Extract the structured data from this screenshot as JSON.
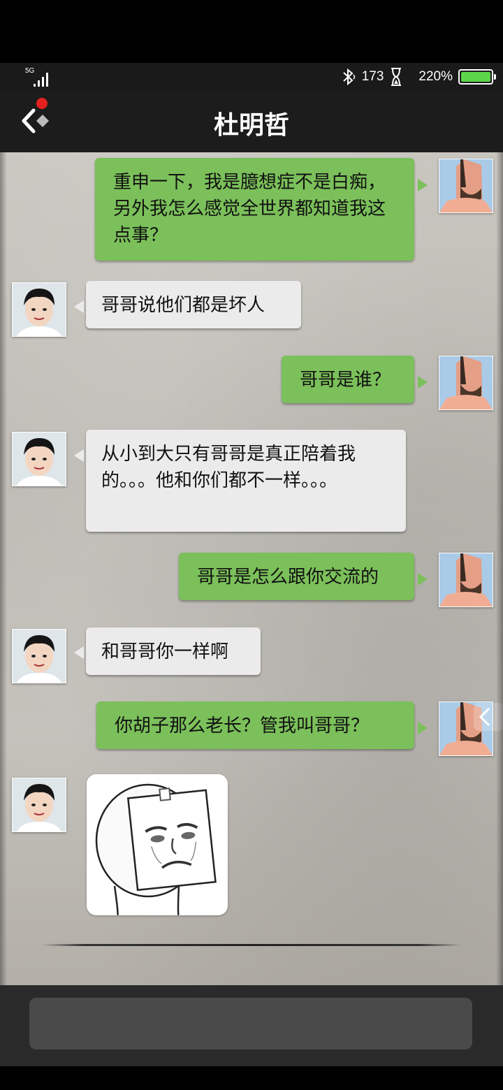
{
  "status_bar": {
    "network": "5G",
    "bluetooth_icon": "bluetooth-icon",
    "speed": "173",
    "hourglass_icon": "hourglass-icon",
    "battery_percent": "220%",
    "battery_level": 1.0,
    "battery_color": "#5cd64a"
  },
  "header": {
    "title": "杜明哲",
    "back_icon": "back-arrow-icon"
  },
  "messages": [
    {
      "sender": "me",
      "text": "重申一下，我是臆想症不是白痴，另外我怎么感觉全世界都知道我这点事？"
    },
    {
      "sender": "other",
      "text": "哥哥说他们都是坏人"
    },
    {
      "sender": "me",
      "text": "哥哥是谁？"
    },
    {
      "sender": "other",
      "text": "从小到大只有哥哥是真正陪着我的。。。他和你们都不一样。。。"
    },
    {
      "sender": "me",
      "text": "哥哥是怎么跟你交流的"
    },
    {
      "sender": "other",
      "text": "和哥哥你一样啊"
    },
    {
      "sender": "me",
      "text": "你胡子那么老长？管我叫哥哥？"
    },
    {
      "sender": "other",
      "type": "sticker",
      "sticker": "sad-meme-face-sticker"
    }
  ],
  "colors": {
    "my_bubble": "#7bc05a",
    "other_bubble": "#ebebeb",
    "header_bg": "#1c1c1c"
  },
  "input": {
    "placeholder": ""
  }
}
